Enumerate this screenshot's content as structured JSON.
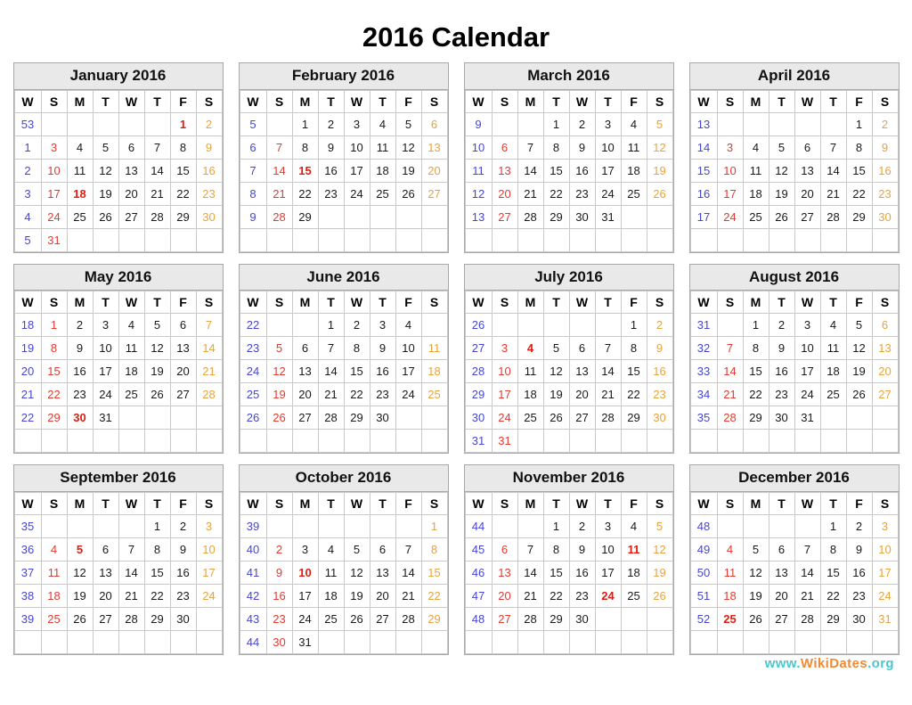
{
  "page": {
    "title": "2016 Calendar",
    "year": "2016"
  },
  "footer": {
    "www": "www.",
    "name": "WikiDates",
    "tld": ".org",
    "full": "www.WikiDates.org"
  },
  "colors": {
    "week_number": "#4646d2",
    "sunday": "#e23a31",
    "saturday": "#e8a33d",
    "weekday": "#1a1a1a",
    "holiday": "#e01b10",
    "month_header_bg": "#e9e9e9",
    "border": "#c9c9c9",
    "brand_teal": "#4cc6cc",
    "brand_orange": "#f08a35"
  },
  "weekday_headers": [
    "W",
    "S",
    "M",
    "T",
    "W",
    "T",
    "F",
    "S"
  ],
  "months": [
    {
      "name": "January 2016",
      "weeks": [
        {
          "wk": "53",
          "days": [
            "",
            "",
            "",
            "",
            "",
            "1",
            "2"
          ],
          "holidays": [
            5
          ]
        },
        {
          "wk": "1",
          "days": [
            "3",
            "4",
            "5",
            "6",
            "7",
            "8",
            "9"
          ],
          "holidays": []
        },
        {
          "wk": "2",
          "days": [
            "10",
            "11",
            "12",
            "13",
            "14",
            "15",
            "16"
          ],
          "holidays": []
        },
        {
          "wk": "3",
          "days": [
            "17",
            "18",
            "19",
            "20",
            "21",
            "22",
            "23"
          ],
          "holidays": [
            1
          ]
        },
        {
          "wk": "4",
          "days": [
            "24",
            "25",
            "26",
            "27",
            "28",
            "29",
            "30"
          ],
          "holidays": []
        },
        {
          "wk": "5",
          "days": [
            "31",
            "",
            "",
            "",
            "",
            "",
            ""
          ],
          "holidays": []
        }
      ]
    },
    {
      "name": "February 2016",
      "weeks": [
        {
          "wk": "5",
          "days": [
            "",
            "1",
            "2",
            "3",
            "4",
            "5",
            "6"
          ],
          "holidays": []
        },
        {
          "wk": "6",
          "days": [
            "7",
            "8",
            "9",
            "10",
            "11",
            "12",
            "13"
          ],
          "holidays": []
        },
        {
          "wk": "7",
          "days": [
            "14",
            "15",
            "16",
            "17",
            "18",
            "19",
            "20"
          ],
          "holidays": [
            1
          ]
        },
        {
          "wk": "8",
          "days": [
            "21",
            "22",
            "23",
            "24",
            "25",
            "26",
            "27"
          ],
          "holidays": []
        },
        {
          "wk": "9",
          "days": [
            "28",
            "29",
            "",
            "",
            "",
            "",
            ""
          ],
          "holidays": []
        },
        {
          "wk": "",
          "days": [
            "",
            "",
            "",
            "",
            "",
            "",
            ""
          ],
          "holidays": []
        }
      ]
    },
    {
      "name": "March 2016",
      "weeks": [
        {
          "wk": "9",
          "days": [
            "",
            "",
            "1",
            "2",
            "3",
            "4",
            "5"
          ],
          "holidays": []
        },
        {
          "wk": "10",
          "days": [
            "6",
            "7",
            "8",
            "9",
            "10",
            "11",
            "12"
          ],
          "holidays": []
        },
        {
          "wk": "11",
          "days": [
            "13",
            "14",
            "15",
            "16",
            "17",
            "18",
            "19"
          ],
          "holidays": []
        },
        {
          "wk": "12",
          "days": [
            "20",
            "21",
            "22",
            "23",
            "24",
            "25",
            "26"
          ],
          "holidays": []
        },
        {
          "wk": "13",
          "days": [
            "27",
            "28",
            "29",
            "30",
            "31",
            "",
            ""
          ],
          "holidays": []
        },
        {
          "wk": "",
          "days": [
            "",
            "",
            "",
            "",
            "",
            "",
            ""
          ],
          "holidays": []
        }
      ]
    },
    {
      "name": "April 2016",
      "weeks": [
        {
          "wk": "13",
          "days": [
            "",
            "",
            "",
            "",
            "",
            "1",
            "2"
          ],
          "holidays": []
        },
        {
          "wk": "14",
          "days": [
            "3",
            "4",
            "5",
            "6",
            "7",
            "8",
            "9"
          ],
          "holidays": []
        },
        {
          "wk": "15",
          "days": [
            "10",
            "11",
            "12",
            "13",
            "14",
            "15",
            "16"
          ],
          "holidays": []
        },
        {
          "wk": "16",
          "days": [
            "17",
            "18",
            "19",
            "20",
            "21",
            "22",
            "23"
          ],
          "holidays": []
        },
        {
          "wk": "17",
          "days": [
            "24",
            "25",
            "26",
            "27",
            "28",
            "29",
            "30"
          ],
          "holidays": []
        },
        {
          "wk": "",
          "days": [
            "",
            "",
            "",
            "",
            "",
            "",
            ""
          ],
          "holidays": []
        }
      ]
    },
    {
      "name": "May 2016",
      "weeks": [
        {
          "wk": "18",
          "days": [
            "1",
            "2",
            "3",
            "4",
            "5",
            "6",
            "7"
          ],
          "holidays": []
        },
        {
          "wk": "19",
          "days": [
            "8",
            "9",
            "10",
            "11",
            "12",
            "13",
            "14"
          ],
          "holidays": []
        },
        {
          "wk": "20",
          "days": [
            "15",
            "16",
            "17",
            "18",
            "19",
            "20",
            "21"
          ],
          "holidays": []
        },
        {
          "wk": "21",
          "days": [
            "22",
            "23",
            "24",
            "25",
            "26",
            "27",
            "28"
          ],
          "holidays": []
        },
        {
          "wk": "22",
          "days": [
            "29",
            "30",
            "31",
            "",
            "",
            "",
            ""
          ],
          "holidays": [
            1
          ]
        },
        {
          "wk": "",
          "days": [
            "",
            "",
            "",
            "",
            "",
            "",
            ""
          ],
          "holidays": []
        }
      ]
    },
    {
      "name": "June 2016",
      "weeks": [
        {
          "wk": "22",
          "days": [
            "",
            "",
            "1",
            "2",
            "3",
            "4",
            ""
          ],
          "holidays": []
        },
        {
          "wk": "23",
          "days": [
            "5",
            "6",
            "7",
            "8",
            "9",
            "10",
            "11"
          ],
          "holidays": []
        },
        {
          "wk": "24",
          "days": [
            "12",
            "13",
            "14",
            "15",
            "16",
            "17",
            "18"
          ],
          "holidays": []
        },
        {
          "wk": "25",
          "days": [
            "19",
            "20",
            "21",
            "22",
            "23",
            "24",
            "25"
          ],
          "holidays": []
        },
        {
          "wk": "26",
          "days": [
            "26",
            "27",
            "28",
            "29",
            "30",
            "",
            ""
          ],
          "holidays": []
        },
        {
          "wk": "",
          "days": [
            "",
            "",
            "",
            "",
            "",
            "",
            ""
          ],
          "holidays": []
        }
      ]
    },
    {
      "name": "July 2016",
      "weeks": [
        {
          "wk": "26",
          "days": [
            "",
            "",
            "",
            "",
            "",
            "1",
            "2"
          ],
          "holidays": []
        },
        {
          "wk": "27",
          "days": [
            "3",
            "4",
            "5",
            "6",
            "7",
            "8",
            "9"
          ],
          "holidays": [
            1
          ]
        },
        {
          "wk": "28",
          "days": [
            "10",
            "11",
            "12",
            "13",
            "14",
            "15",
            "16"
          ],
          "holidays": []
        },
        {
          "wk": "29",
          "days": [
            "17",
            "18",
            "19",
            "20",
            "21",
            "22",
            "23"
          ],
          "holidays": []
        },
        {
          "wk": "30",
          "days": [
            "24",
            "25",
            "26",
            "27",
            "28",
            "29",
            "30"
          ],
          "holidays": []
        },
        {
          "wk": "31",
          "days": [
            "31",
            "",
            "",
            "",
            "",
            "",
            ""
          ],
          "holidays": []
        }
      ]
    },
    {
      "name": "August 2016",
      "weeks": [
        {
          "wk": "31",
          "days": [
            "",
            "1",
            "2",
            "3",
            "4",
            "5",
            "6"
          ],
          "holidays": []
        },
        {
          "wk": "32",
          "days": [
            "7",
            "8",
            "9",
            "10",
            "11",
            "12",
            "13"
          ],
          "holidays": []
        },
        {
          "wk": "33",
          "days": [
            "14",
            "15",
            "16",
            "17",
            "18",
            "19",
            "20"
          ],
          "holidays": []
        },
        {
          "wk": "34",
          "days": [
            "21",
            "22",
            "23",
            "24",
            "25",
            "26",
            "27"
          ],
          "holidays": []
        },
        {
          "wk": "35",
          "days": [
            "28",
            "29",
            "30",
            "31",
            "",
            "",
            ""
          ],
          "holidays": []
        },
        {
          "wk": "",
          "days": [
            "",
            "",
            "",
            "",
            "",
            "",
            ""
          ],
          "holidays": []
        }
      ]
    },
    {
      "name": "September 2016",
      "weeks": [
        {
          "wk": "35",
          "days": [
            "",
            "",
            "",
            "",
            "1",
            "2",
            "3"
          ],
          "holidays": []
        },
        {
          "wk": "36",
          "days": [
            "4",
            "5",
            "6",
            "7",
            "8",
            "9",
            "10"
          ],
          "holidays": [
            1
          ]
        },
        {
          "wk": "37",
          "days": [
            "11",
            "12",
            "13",
            "14",
            "15",
            "16",
            "17"
          ],
          "holidays": []
        },
        {
          "wk": "38",
          "days": [
            "18",
            "19",
            "20",
            "21",
            "22",
            "23",
            "24"
          ],
          "holidays": []
        },
        {
          "wk": "39",
          "days": [
            "25",
            "26",
            "27",
            "28",
            "29",
            "30",
            ""
          ],
          "holidays": []
        },
        {
          "wk": "",
          "days": [
            "",
            "",
            "",
            "",
            "",
            "",
            ""
          ],
          "holidays": []
        }
      ]
    },
    {
      "name": "October 2016",
      "weeks": [
        {
          "wk": "39",
          "days": [
            "",
            "",
            "",
            "",
            "",
            "",
            "1"
          ],
          "holidays": []
        },
        {
          "wk": "40",
          "days": [
            "2",
            "3",
            "4",
            "5",
            "6",
            "7",
            "8"
          ],
          "holidays": []
        },
        {
          "wk": "41",
          "days": [
            "9",
            "10",
            "11",
            "12",
            "13",
            "14",
            "15"
          ],
          "holidays": [
            1
          ]
        },
        {
          "wk": "42",
          "days": [
            "16",
            "17",
            "18",
            "19",
            "20",
            "21",
            "22"
          ],
          "holidays": []
        },
        {
          "wk": "43",
          "days": [
            "23",
            "24",
            "25",
            "26",
            "27",
            "28",
            "29"
          ],
          "holidays": []
        },
        {
          "wk": "44",
          "days": [
            "30",
            "31",
            "",
            "",
            "",
            "",
            ""
          ],
          "holidays": []
        }
      ]
    },
    {
      "name": "November 2016",
      "weeks": [
        {
          "wk": "44",
          "days": [
            "",
            "",
            "1",
            "2",
            "3",
            "4",
            "5"
          ],
          "holidays": []
        },
        {
          "wk": "45",
          "days": [
            "6",
            "7",
            "8",
            "9",
            "10",
            "11",
            "12"
          ],
          "holidays": [
            5
          ]
        },
        {
          "wk": "46",
          "days": [
            "13",
            "14",
            "15",
            "16",
            "17",
            "18",
            "19"
          ],
          "holidays": []
        },
        {
          "wk": "47",
          "days": [
            "20",
            "21",
            "22",
            "23",
            "24",
            "25",
            "26"
          ],
          "holidays": [
            4
          ]
        },
        {
          "wk": "48",
          "days": [
            "27",
            "28",
            "29",
            "30",
            "",
            "",
            ""
          ],
          "holidays": []
        },
        {
          "wk": "",
          "days": [
            "",
            "",
            "",
            "",
            "",
            "",
            ""
          ],
          "holidays": []
        }
      ]
    },
    {
      "name": "December 2016",
      "weeks": [
        {
          "wk": "48",
          "days": [
            "",
            "",
            "",
            "",
            "1",
            "2",
            "3"
          ],
          "holidays": []
        },
        {
          "wk": "49",
          "days": [
            "4",
            "5",
            "6",
            "7",
            "8",
            "9",
            "10"
          ],
          "holidays": []
        },
        {
          "wk": "50",
          "days": [
            "11",
            "12",
            "13",
            "14",
            "15",
            "16",
            "17"
          ],
          "holidays": []
        },
        {
          "wk": "51",
          "days": [
            "18",
            "19",
            "20",
            "21",
            "22",
            "23",
            "24"
          ],
          "holidays": []
        },
        {
          "wk": "52",
          "days": [
            "25",
            "26",
            "27",
            "28",
            "29",
            "30",
            "31"
          ],
          "holidays": [
            0
          ]
        },
        {
          "wk": "",
          "days": [
            "",
            "",
            "",
            "",
            "",
            "",
            ""
          ],
          "holidays": []
        }
      ]
    }
  ]
}
